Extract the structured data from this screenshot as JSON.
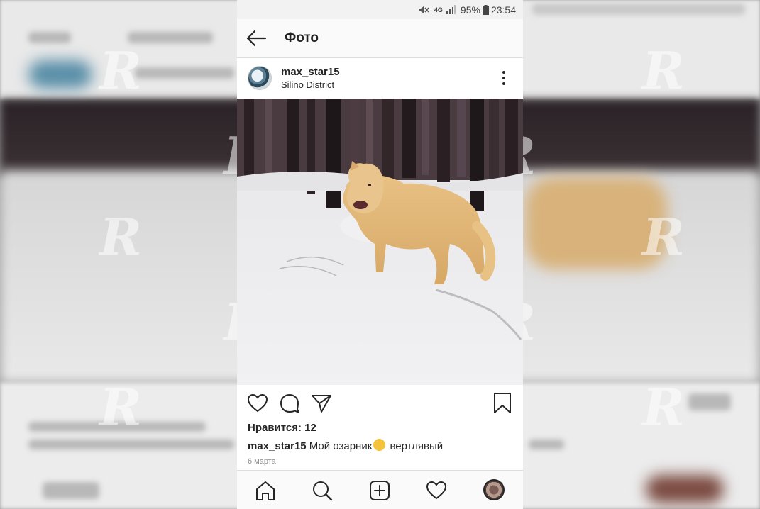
{
  "status_bar": {
    "battery": "95%",
    "time": "23:54",
    "network": "4G"
  },
  "top_bar": {
    "title": "Фото"
  },
  "post": {
    "username": "max_star15",
    "location": "Silino District",
    "likes": "Нравится: 12",
    "caption_user": "max_star15",
    "caption_before": "Мой озарник",
    "caption_after": "вертлявый",
    "date": "6 марта"
  },
  "icons": {
    "top": [
      "back-arrow-icon",
      "more-options-icon"
    ],
    "actions": [
      "heart-icon",
      "comment-icon",
      "share-icon",
      "bookmark-icon"
    ],
    "nav": [
      "home-icon",
      "search-icon",
      "add-icon",
      "heart-icon",
      "profile-avatar"
    ]
  },
  "colors": {
    "text": "#262626",
    "secondary": "#8e8e8e",
    "bar": "#fafafa"
  }
}
